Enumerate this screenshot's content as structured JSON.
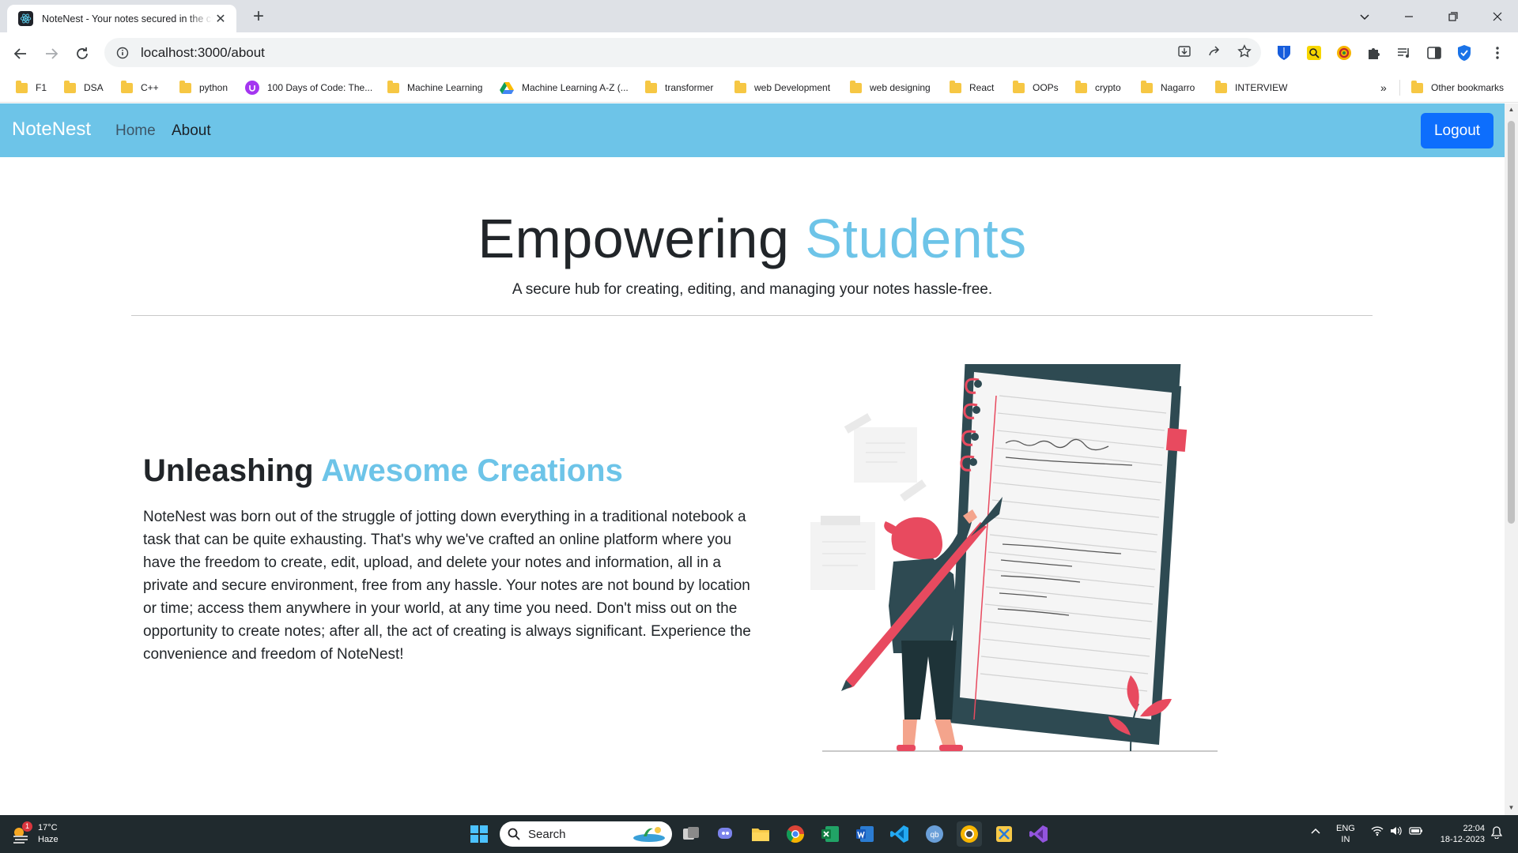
{
  "browser": {
    "tab_title": "NoteNest - Your notes secured in the cloud",
    "url": "localhost:3000/about",
    "bookmarks": [
      {
        "label": "F1",
        "icon": "folder-icon"
      },
      {
        "label": "DSA",
        "icon": "folder-icon"
      },
      {
        "label": "C++",
        "icon": "folder-icon"
      },
      {
        "label": "python",
        "icon": "folder-icon"
      },
      {
        "label": "100 Days of Code: The...",
        "icon": "udemy-icon"
      },
      {
        "label": "Machine Learning",
        "icon": "folder-icon"
      },
      {
        "label": "Machine Learning A-Z (...",
        "icon": "drive-icon"
      },
      {
        "label": "transformer",
        "icon": "folder-icon"
      },
      {
        "label": "web Development",
        "icon": "folder-icon"
      },
      {
        "label": "web designing",
        "icon": "folder-icon"
      },
      {
        "label": "React",
        "icon": "folder-icon"
      },
      {
        "label": "OOPs",
        "icon": "folder-icon"
      },
      {
        "label": "crypto",
        "icon": "folder-icon"
      },
      {
        "label": "Nagarro",
        "icon": "folder-icon"
      },
      {
        "label": "INTERVIEW",
        "icon": "folder-icon"
      }
    ],
    "overflow_label": "»",
    "other_bookmarks": "Other bookmarks"
  },
  "navbar": {
    "brand": "NoteNest",
    "links": [
      "Home",
      "About"
    ],
    "active": "About",
    "logout_label": "Logout",
    "color": "#6dc4e8"
  },
  "hero": {
    "title_part1": "Empowering ",
    "title_part2": "Students",
    "subtitle": "A secure hub for creating, editing, and managing your notes hassle-free."
  },
  "section": {
    "title_part1": "Unleashing ",
    "title_part2": "Awesome Creations",
    "body": "NoteNest was born out of the struggle of jotting down everything in a traditional notebook a task that can be quite exhausting. That's why we've crafted an online platform where you have the freedom to create, edit, upload, and delete your notes and information, all in a private and secure environment, free from any hassle. Your notes are not bound by location or time; access them anywhere in your world, at any time you need. Don't miss out on the opportunity to create notes; after all, the act of creating is always significant. Experience the convenience and freedom of NoteNest!"
  },
  "taskbar": {
    "weather_temp": "17°C",
    "weather_desc": "Haze",
    "weather_badge": "1",
    "search_placeholder": "Search",
    "lang_line1": "ENG",
    "lang_line2": "IN",
    "time": "22:04",
    "date": "18-12-2023"
  },
  "colors": {
    "accent": "#6dc4e8",
    "primary_button": "#0d6efd",
    "illustration_red": "#e84a5f",
    "illustration_dark": "#2e4a52"
  }
}
